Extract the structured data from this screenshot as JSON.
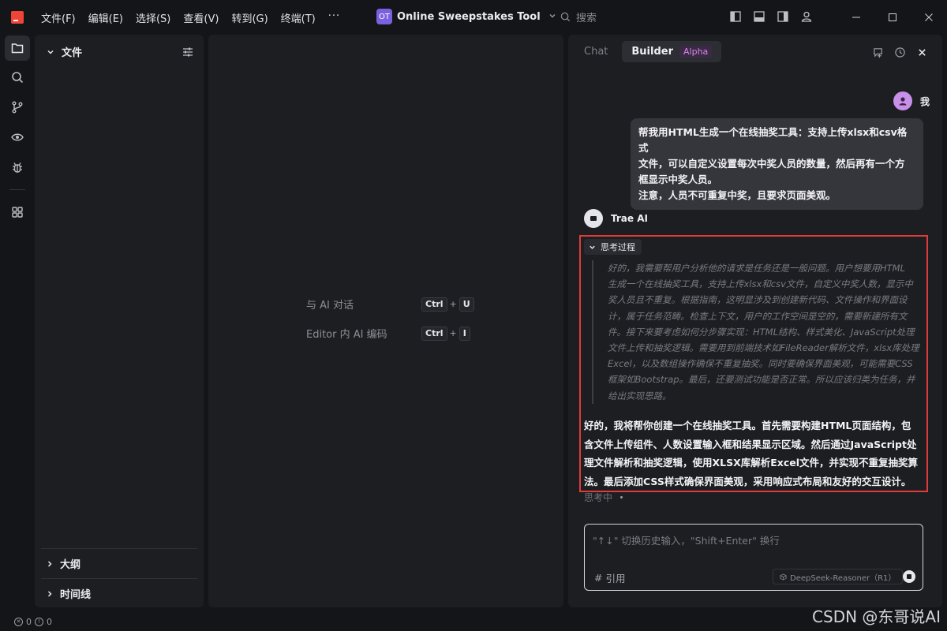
{
  "menu": {
    "items": [
      "文件(F)",
      "编辑(E)",
      "选择(S)",
      "查看(V)",
      "转到(G)",
      "终端(T)"
    ],
    "more": "···"
  },
  "project": {
    "badge": "OT",
    "name": "Online Sweepstakes Tool"
  },
  "search": {
    "placeholder": "搜索"
  },
  "explorer": {
    "title": "文件",
    "sections": [
      "大纲",
      "时间线"
    ]
  },
  "editor": {
    "shortcuts": [
      {
        "label": "与 AI 对话",
        "keys": [
          "Ctrl",
          "U"
        ]
      },
      {
        "label": "Editor 内 AI 编码",
        "keys": [
          "Ctrl",
          "I"
        ]
      }
    ],
    "plus": "+"
  },
  "chat": {
    "tabs": {
      "chat": "Chat",
      "builder": "Builder",
      "badge": "Alpha"
    },
    "user": {
      "name": "我",
      "message_lines": [
        "帮我用HTML生成一个在线抽奖工具：支持上传xlsx和csv格式",
        "文件，可以自定义设置每次中奖人员的数量，然后再有一个方",
        "框显示中奖人员。",
        "注意，人员不可重复中奖，且要求页面美观。"
      ]
    },
    "ai": {
      "name": "Trae AI",
      "thinking_label": "思考过程",
      "thinking_lines": [
        "好的，我需要帮用户分析他的请求是任务还是一般问题。用户想要用HTML",
        "生成一个在线抽奖工具，支持上传xlsx和csv文件，自定义中奖人数，显示中",
        "奖人员且不重复。根据指南，这明显涉及到创建新代码、文件操作和界面设",
        "计，属于任务范畴。检查上下文，用户的工作空间是空的，需要新建所有文",
        "件。接下来要考虑如何分步骤实现：HTML结构、样式美化、JavaScript处理",
        "文件上传和抽奖逻辑。需要用到前端技术如FileReader解析文件，xlsx库处理",
        "Excel，以及数组操作确保不重复抽奖。同时要确保界面美观，可能需要CSS",
        "框架如Bootstrap。最后，还要测试功能是否正常。所以应该归类为任务，并",
        "给出实现思路。"
      ],
      "answer_lines": [
        "好的，我将帮你创建一个在线抽奖工具。首先需要构建HTML页面结构，包",
        "含文件上传组件、人数设置输入框和结果显示区域。然后通过JavaScript处",
        "理文件解析和抽奖逻辑，使用XLSX库解析Excel文件，并实现不重复抽奖算",
        "法。最后添加CSS样式确保界面美观，采用响应式布局和友好的交互设计。"
      ],
      "status": "思考中"
    },
    "input": {
      "placeholder": "\"↑↓\" 切换历史输入，\"Shift+Enter\" 换行",
      "cite": "引用",
      "cite_symbol": "#",
      "model": "DeepSeek-Reasoner（R1）"
    }
  },
  "statusbar": {
    "errors": "0",
    "warnings": "0"
  },
  "watermark": "CSDN @东哥说AI",
  "colors": {
    "accent_red": "#e03b3b",
    "project_badge": "#7b61e0",
    "alpha_badge_text": "#d988e0",
    "user_avatar": "#c890e8"
  }
}
